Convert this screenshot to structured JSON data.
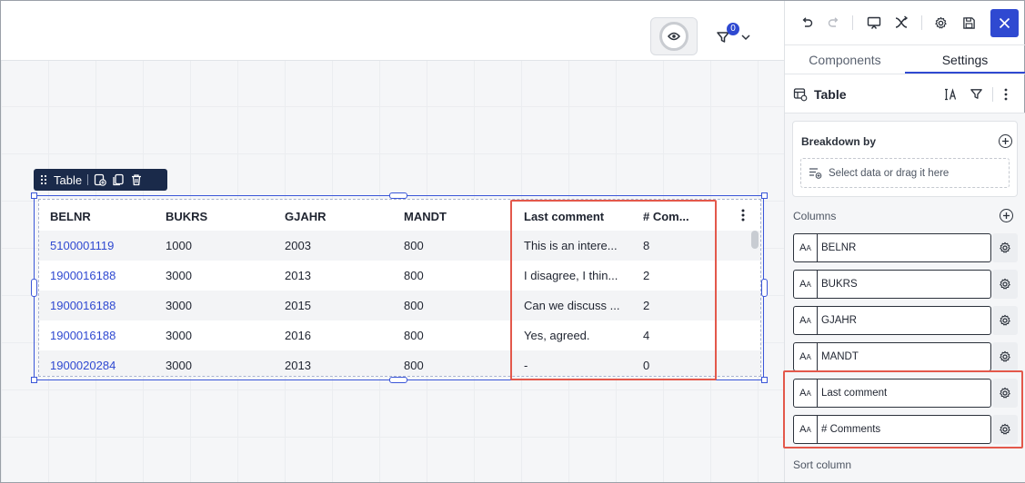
{
  "canvas": {
    "filter_badge": "0"
  },
  "table_toolbar": {
    "label": "Table"
  },
  "table": {
    "columns": [
      "BELNR",
      "BUKRS",
      "GJAHR",
      "MANDT",
      "Last comment",
      "# Com..."
    ],
    "rows": [
      [
        "5100001119",
        "1000",
        "2003",
        "800",
        "This is an intere...",
        "8"
      ],
      [
        "1900016188",
        "3000",
        "2013",
        "800",
        "I disagree, I thin...",
        "2"
      ],
      [
        "1900016188",
        "3000",
        "2015",
        "800",
        "Can we discuss ...",
        "2"
      ],
      [
        "1900016188",
        "3000",
        "2016",
        "800",
        "Yes, agreed.",
        "4"
      ],
      [
        "1900020284",
        "3000",
        "2013",
        "800",
        "-",
        "0"
      ]
    ]
  },
  "panel": {
    "tabs": [
      "Components",
      "Settings"
    ],
    "active_tab": "Settings",
    "section_title": "Table",
    "breakdown_label": "Breakdown by",
    "breakdown_placeholder": "Select data or drag it here",
    "columns_label": "Columns",
    "column_items": [
      "BELNR",
      "BUKRS",
      "GJAHR",
      "MANDT",
      "Last comment",
      "# Comments"
    ],
    "column_type_icon": "text-type-icon",
    "sort_label": "Sort column"
  },
  "colors": {
    "accent": "#2f49d1",
    "highlight": "#e3584b",
    "toolbar_bg": "#1a2a4a"
  }
}
